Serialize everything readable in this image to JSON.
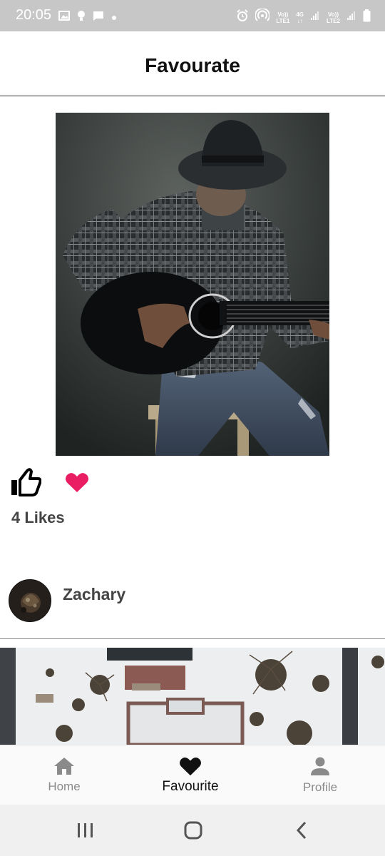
{
  "status_bar": {
    "time": "20:05",
    "left_icons": [
      "image-icon",
      "bulb-icon",
      "chat-icon",
      "dot-icon"
    ],
    "right_icons": [
      "alarm-icon",
      "hotspot-icon",
      "volte1-icon",
      "4g-icon",
      "signal1-icon",
      "volte2-icon",
      "signal2-icon",
      "battery-icon"
    ],
    "volte1": {
      "top": "Vo))",
      "bottom": "LTE1"
    },
    "net": {
      "top": "4G",
      "bottom": "↓↑"
    },
    "volte2": {
      "top": "Vo))",
      "bottom": "LTE2"
    }
  },
  "app_bar": {
    "title": "Favourate"
  },
  "posts": [
    {
      "image": "guitar-player-photo",
      "likes_text": "4 Likes",
      "liked": false,
      "favourited": true
    },
    {
      "author": "Zachary",
      "image": "snowy-aerial-photo"
    }
  ],
  "bottom_nav": {
    "items": [
      {
        "label": "Home",
        "icon": "home-icon",
        "active": false
      },
      {
        "label": "Favourite",
        "icon": "heart-icon",
        "active": true
      },
      {
        "label": "Profile",
        "icon": "person-icon",
        "active": false
      }
    ]
  },
  "system_nav": {
    "buttons": [
      "recents-icon",
      "home-circle-icon",
      "back-icon"
    ]
  },
  "colors": {
    "heart_accent": "#e91e63",
    "active_nav": "#111111",
    "inactive_nav": "#8a8a8a"
  }
}
